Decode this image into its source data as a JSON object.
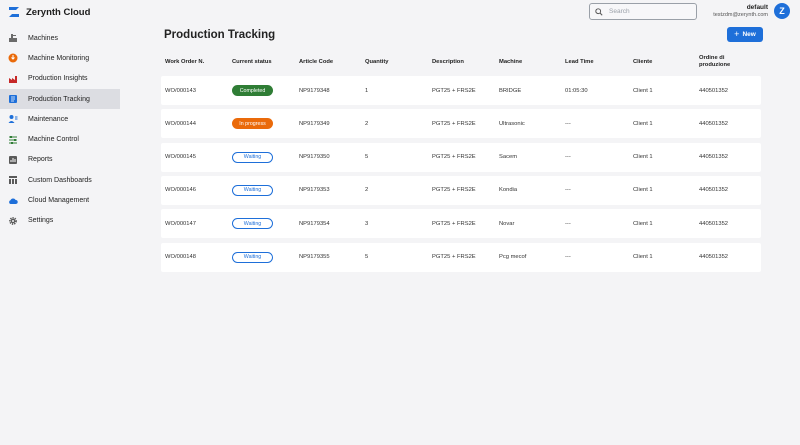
{
  "app": {
    "title": "Zerynth Cloud"
  },
  "search": {
    "placeholder": "Search"
  },
  "user": {
    "name": "default",
    "email": "testzdm@zerynth.com",
    "initial": "Z"
  },
  "colors": {
    "accent": "#1e6fd9",
    "completed": "#2f7d35",
    "in_progress": "#ea6a0a"
  },
  "sidebar": {
    "items": [
      {
        "label": "Machines",
        "icon": "machines-icon"
      },
      {
        "label": "Machine Monitoring",
        "icon": "monitoring-icon"
      },
      {
        "label": "Production Insights",
        "icon": "factory-icon"
      },
      {
        "label": "Production Tracking",
        "icon": "tracking-icon",
        "active": true
      },
      {
        "label": "Maintenance",
        "icon": "maintenance-icon"
      },
      {
        "label": "Machine Control",
        "icon": "control-icon"
      },
      {
        "label": "Reports",
        "icon": "reports-icon"
      },
      {
        "label": "Custom Dashboards",
        "icon": "dashboard-icon"
      },
      {
        "label": "Cloud Management",
        "icon": "cloud-icon"
      },
      {
        "label": "Settings",
        "icon": "gear-icon"
      }
    ]
  },
  "main": {
    "title": "Production Tracking",
    "new_label": "New",
    "columns": [
      "Work Order N.",
      "Current status",
      "Article Code",
      "Quantity",
      "Description",
      "Machine",
      "Lead Time",
      "Cliente",
      "Ordine di produzione"
    ],
    "rows": [
      {
        "work_order": "WO/000143",
        "status": "Completed",
        "status_type": "completed",
        "article": "NP9179348",
        "quantity": "1",
        "description": "PGT25 + FRS2E",
        "machine": "BRIDGE",
        "lead_time": "01:05:30",
        "client": "Client 1",
        "order": "440501352"
      },
      {
        "work_order": "WO/000144",
        "status": "In progress",
        "status_type": "progress",
        "article": "NP9179349",
        "quantity": "2",
        "description": "PGT25 + FRS2E",
        "machine": "Ultrasonic",
        "lead_time": "---",
        "client": "Client 1",
        "order": "440501352"
      },
      {
        "work_order": "WO/000145",
        "status": "Waiting",
        "status_type": "waiting",
        "article": "NP9179350",
        "quantity": "5",
        "description": "PGT25 + FRS2E",
        "machine": "Sacem",
        "lead_time": "---",
        "client": "Client 1",
        "order": "440501352"
      },
      {
        "work_order": "WO/000146",
        "status": "Waiting",
        "status_type": "waiting",
        "article": "NP9179353",
        "quantity": "2",
        "description": "PGT25 + FRS2E",
        "machine": "Kondia",
        "lead_time": "---",
        "client": "Client 1",
        "order": "440501352"
      },
      {
        "work_order": "WO/000147",
        "status": "Waiting",
        "status_type": "waiting",
        "article": "NP9179354",
        "quantity": "3",
        "description": "PGT25 + FRS2E",
        "machine": "Novar",
        "lead_time": "---",
        "client": "Client 1",
        "order": "440501352"
      },
      {
        "work_order": "WO/000148",
        "status": "Waiting",
        "status_type": "waiting",
        "article": "NP9179355",
        "quantity": "5",
        "description": "PGT25 + FRS2E",
        "machine": "Pcg mecof",
        "lead_time": "---",
        "client": "Client 1",
        "order": "440501352"
      }
    ]
  }
}
